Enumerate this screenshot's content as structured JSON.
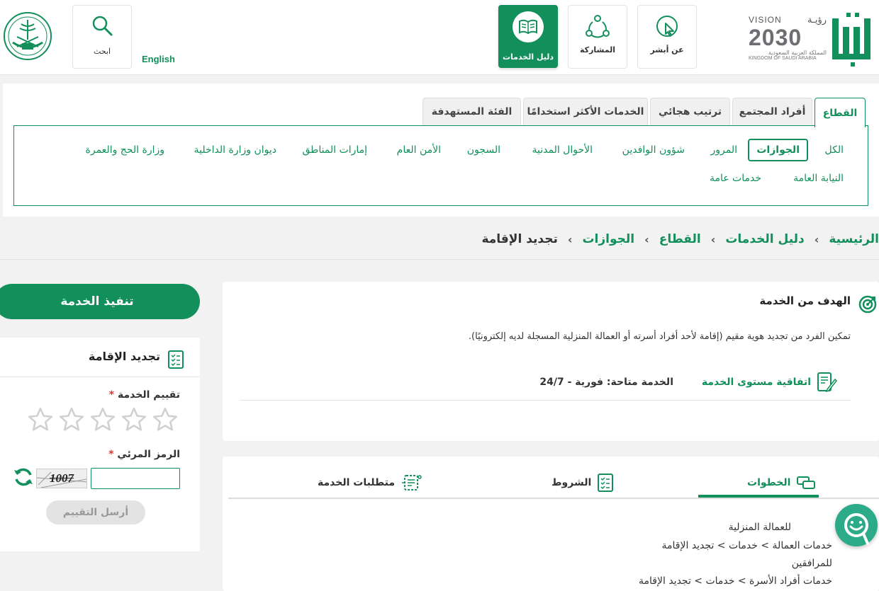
{
  "header": {
    "brand": "أبشر",
    "vision": {
      "line1": "VISION",
      "line2": "رؤيـة",
      "year": "2030",
      "ar_kingdom": "المملكة العربية السعودية",
      "en_kingdom": "KINGDOM OF SAUDI ARABIA"
    },
    "nav": [
      {
        "label": "عن أبشر",
        "icon": "cursor-icon"
      },
      {
        "label": "المشاركة",
        "icon": "share-icon"
      },
      {
        "label": "دليل الخدمات",
        "icon": "book-icon",
        "active": true
      }
    ],
    "language": "English",
    "search_label": "ابحث"
  },
  "tabs": [
    "القطاع",
    "أفراد المجتمع",
    "ترتيب هجائي",
    "الخدمات الأكثر استخدامًا",
    "الفئة المستهدفة"
  ],
  "sectors_row1": [
    "الكل",
    "الجوازات",
    "المرور",
    "شؤون الوافدين",
    "الأحوال المدنية",
    "السجون",
    "الأمن العام",
    "إمارات المناطق",
    "ديوان وزارة الداخلية",
    "وزارة الحج والعمرة"
  ],
  "sectors_row2": [
    "النيابة العامة",
    "خدمات عامة"
  ],
  "breadcrumb": {
    "items": [
      "الرئيسية",
      "دليل الخدمات",
      "القطاع",
      "الجوازات"
    ],
    "separator": "›",
    "current": "تجديد الإقامة"
  },
  "goal": {
    "title": "الهدف من الخدمة",
    "description": "تمكين الفرد من تجديد هوية مقيم (إقامة لأحد أفراد أسرته أو العمالة المنزلية المسجلة لديه إلكترونيًا).",
    "sla_label": "اتفاقية مستوى الخدمة",
    "availability_label": "الخدمة متاحة:",
    "availability_value": "فورية - 24/7"
  },
  "sidebar": {
    "execute_label": "تنفيذ الخدمة",
    "service_name": "تجديد الإقامة",
    "rating_label": "تقييم الخدمة",
    "required_mark": "*",
    "stars": 5,
    "captcha_label": "الرمز المرئي",
    "captcha_text": "1007",
    "captcha_value": "",
    "submit_label": "أرسل التقييم"
  },
  "lower_tabs": [
    "الخطوات",
    "الشروط",
    "متطلبات الخدمة"
  ],
  "steps": [
    "للعمالة المنزلية",
    "خدمات العمالة > خدمات > تجديد الإقامة",
    "للمرافقين",
    "خدمات أفراد الأسرة > خدمات > تجديد الإقامة"
  ],
  "colors": {
    "primary": "#128f5b",
    "required": "#d33333"
  }
}
